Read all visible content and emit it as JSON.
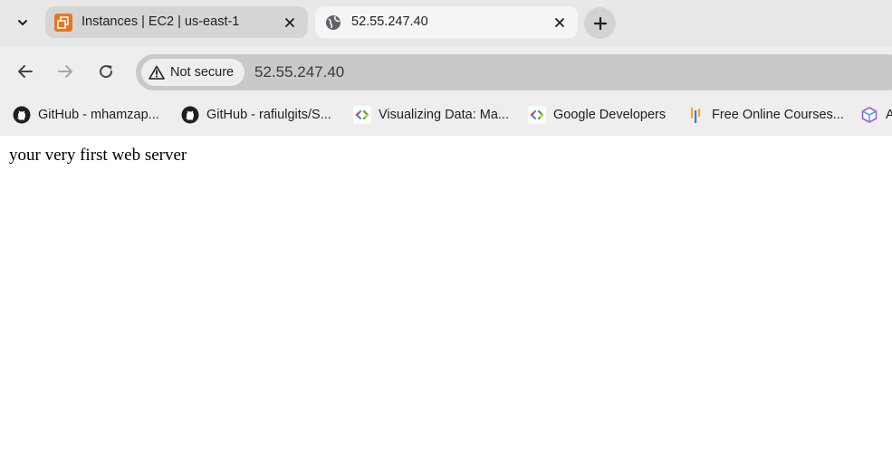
{
  "tabs": [
    {
      "title": "Instances | EC2 | us-east-1",
      "active": false,
      "favicon": "aws-ec2-icon"
    },
    {
      "title": "52.55.247.40",
      "active": true,
      "favicon": "globe-icon"
    }
  ],
  "toolbar": {
    "security_chip": {
      "label": "Not secure",
      "icon": "warning-icon"
    },
    "url": "52.55.247.40"
  },
  "bookmarks": [
    {
      "label": "GitHub - mhamzap...",
      "icon": "github-icon"
    },
    {
      "label": "GitHub - rafiulgits/S...",
      "icon": "github-icon"
    },
    {
      "label": "Visualizing Data: Ma...",
      "icon": "google-developers-icon"
    },
    {
      "label": "Google Developers",
      "icon": "google-developers-icon"
    },
    {
      "label": "Free Online Courses...",
      "icon": "courses-icon"
    },
    {
      "label": "A",
      "icon": "cube-icon"
    }
  ],
  "page": {
    "text": "your very first web server"
  },
  "colors": {
    "tabstrip_bg": "#e8e8e8",
    "toolbar_bg": "#eeeeee",
    "omnibox_bg": "#c9c9c9",
    "aws_orange": "#e8761e"
  }
}
